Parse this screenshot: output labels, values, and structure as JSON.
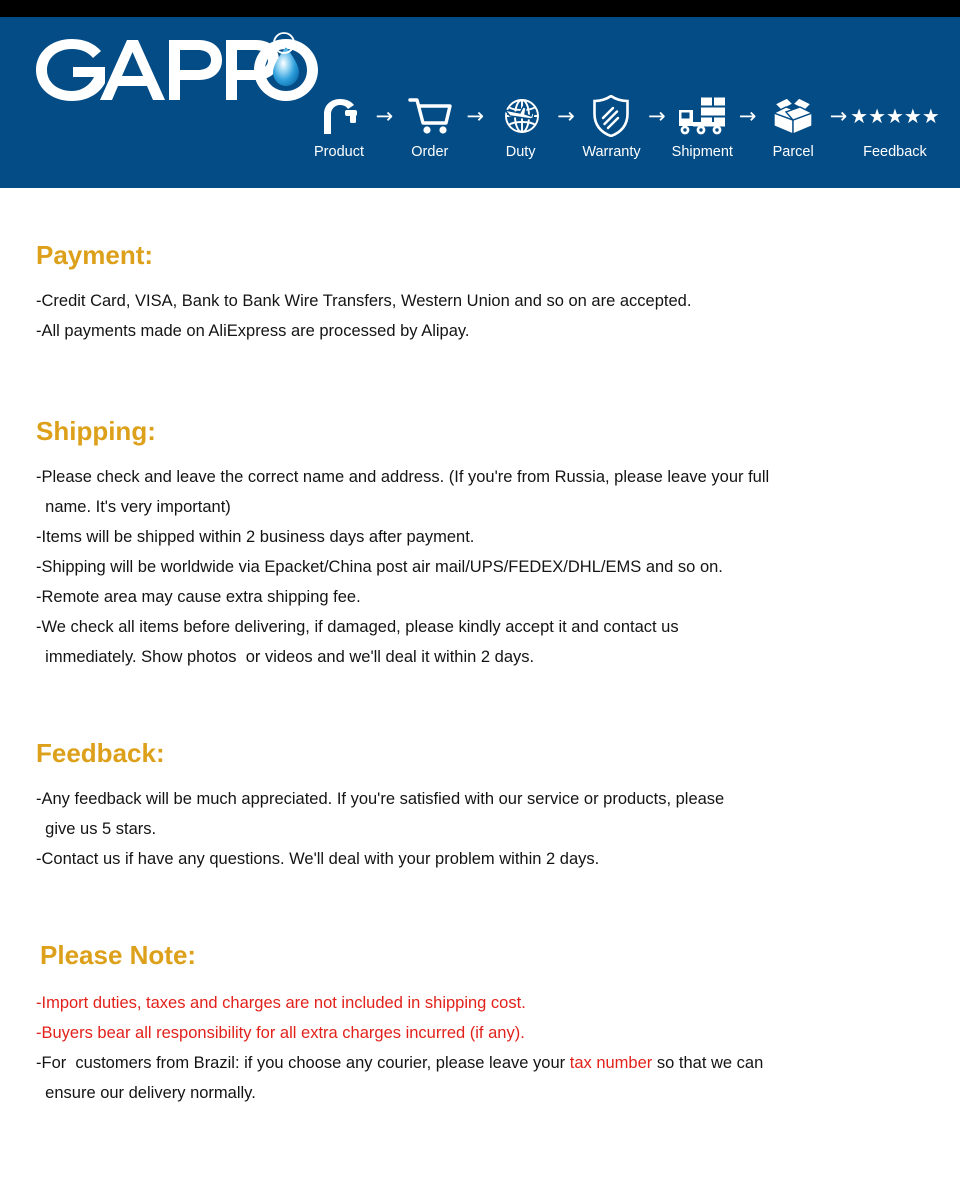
{
  "brand": {
    "name": "GAPPO",
    "trademark_symbol": "®",
    "header_bg": "#034C86",
    "top_bar_bg": "#000000",
    "heading_color": "#DDA01A",
    "alert_color": "#E2211B",
    "logo_drop_color": "#29A3DC"
  },
  "process": {
    "arrow_glyph": "→",
    "steps": [
      {
        "label": "Product",
        "icon": "faucet-icon"
      },
      {
        "label": "Order",
        "icon": "shopping-cart-icon"
      },
      {
        "label": "Duty",
        "icon": "globe-airplane-icon"
      },
      {
        "label": "Warranty",
        "icon": "shield-icon"
      },
      {
        "label": "Shipment",
        "icon": "truck-icon"
      },
      {
        "label": "Parcel",
        "icon": "open-box-icon"
      },
      {
        "label": "Feedback",
        "icon": "five-stars-icon",
        "stars": "★★★★★"
      }
    ]
  },
  "sections": {
    "payment": {
      "heading": "Payment:",
      "lines": [
        "-Credit Card, VISA, Bank to Bank Wire Transfers, Western Union and so on are accepted.",
        "-All payments made on AliExpress are processed by Alipay."
      ]
    },
    "shipping": {
      "heading": "Shipping:",
      "lines": [
        "-Please check and leave the correct name and address. (If you're from Russia, please leave your full",
        "  name. It's very important)",
        "-Items will be shipped within 2 business days after payment.",
        "-Shipping will be worldwide via Epacket/China post air mail/UPS/FEDEX/DHL/EMS and so on.",
        "-Remote area may cause extra shipping fee.",
        "-We check all items before delivering, if damaged, please kindly accept it and contact us",
        "  immediately. Show photos  or videos and we'll deal it within 2 days."
      ]
    },
    "feedback": {
      "heading": "Feedback:",
      "lines": [
        "-Any feedback will be much appreciated. If you're satisfied with our service or products, please",
        "  give us 5 stars.",
        "-Contact us if have any questions. We'll deal with your problem within 2 days."
      ]
    },
    "note": {
      "heading": "Please Note:",
      "lines": [
        "-Import duties, taxes and charges are not included in shipping cost.",
        "-Buyers bear all responsibility for all extra charges incurred (if any)."
      ],
      "brazil_line": {
        "before": "-For  customers from Brazil: if you choose any courier, please leave your ",
        "highlight": "tax number",
        "after": " so that we can"
      },
      "brazil_line_2": "  ensure our delivery normally."
    }
  }
}
